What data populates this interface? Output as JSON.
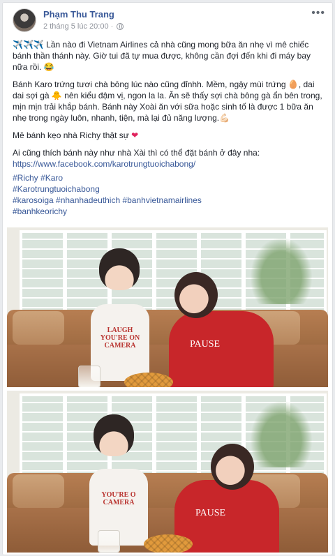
{
  "post": {
    "author": "Phạm Thu Trang",
    "timestamp": "2 tháng 5 lúc 20:00",
    "audience_icon": "globe-icon",
    "more_icon": "more-options-icon"
  },
  "content": {
    "p1": "Lần nào đi Vietnam Airlines cả nhà cũng mong bữa ăn nhẹ vì mê chiếc bánh thần thánh này. Giờ tui đã tự mua được, không cần đợi đến khi đi máy bay nữa rồi.",
    "p1_prefix_emoji": "✈️✈️✈️",
    "p1_suffix_emoji": "😂",
    "p2a": "Bánh Karo trứng tươi chà bông lúc nào cũng đỉnhh. Mềm, ngậy mùi trứng",
    "p2_emoji_egg": "🥚",
    "p2b": ", dai dai sợi gà",
    "p2_emoji_chick": "🐥",
    "p2c": "nên kiểu đậm vị, ngon la la. Ăn sẽ thấy sợi chà bông gà ẩn bên trong, mịn mịn trải khắp bánh. Bánh này Xoài ăn với sữa hoặc sinh tố là được 1 bữa ăn nhẹ trong ngày luôn, nhanh, tiện, mà lại đủ năng lượng.",
    "p2_emoji_muscle": "💪🏻",
    "p3": "Mê bánh kẹo nhà Richy thật sự",
    "p3_emoji": "❤",
    "p4": "Ai cũng thích bánh này như nhà Xài thì có thể đặt bánh ở đây nha:",
    "link": "https://www.facebook.com/karotrungtuoichabong/",
    "hashtags": [
      "#Richy #Karo",
      "#Karotrungtuoichabong",
      "#karosoiga #nhanhadeuthich #banhvietnamairlines",
      "#banhkeorichy"
    ]
  },
  "photos": {
    "boy_shirt_text_1": "LAUGH\nYOU'RE ON\nCAMERA",
    "boy_shirt_text_2": "YOU'RE O\nCAMERA",
    "woman_shirt_text": "PAUSE"
  },
  "colors": {
    "link": "#385898",
    "text": "#1d2129",
    "meta": "#90949c",
    "background": "#e9ebee",
    "heart": "#e0245e"
  }
}
